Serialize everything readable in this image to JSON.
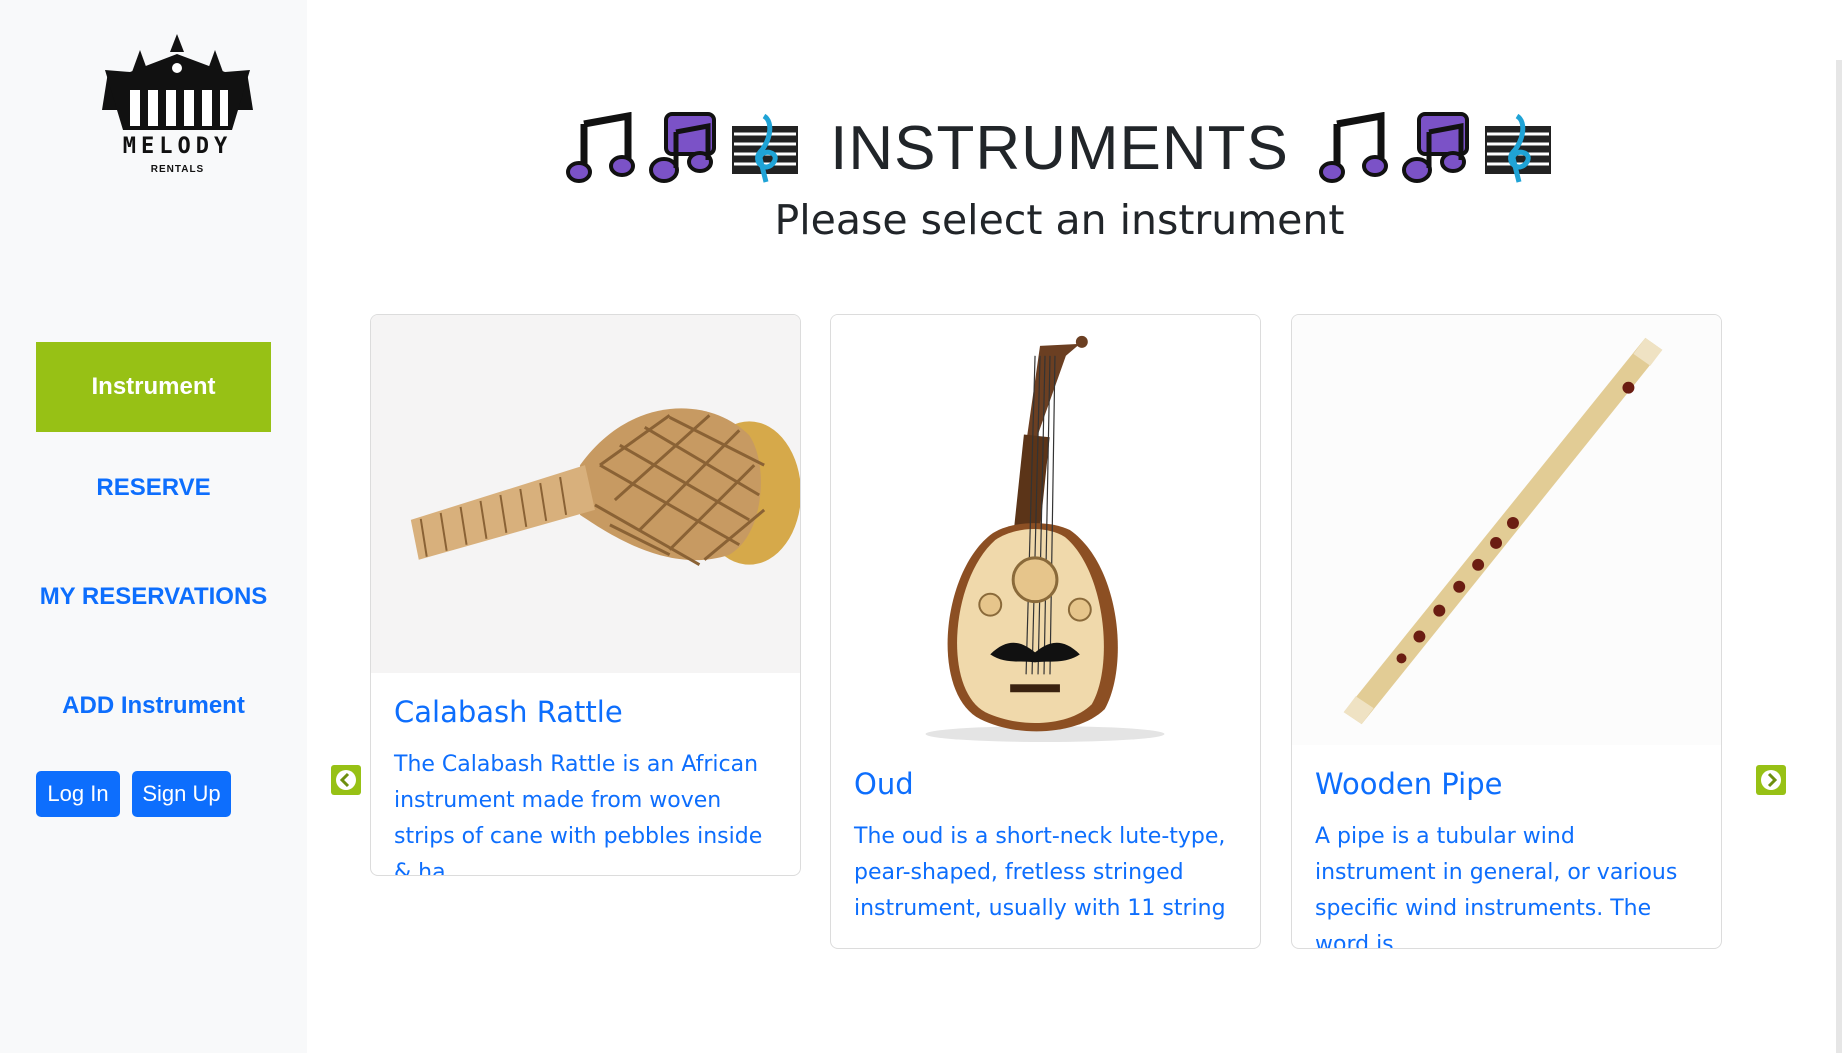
{
  "brand": {
    "name": "MELODY",
    "sub": "RENTALS"
  },
  "sidebar": {
    "items": [
      {
        "label": "Instrument",
        "active": true
      },
      {
        "label": "RESERVE"
      },
      {
        "label": "MY RESERVATIONS"
      },
      {
        "label": "ADD Instrument"
      }
    ],
    "login_label": "Log In",
    "signup_label": "Sign Up"
  },
  "header": {
    "title": "INSTRUMENTS",
    "subtitle": "Please select an instrument",
    "icons": [
      "musical-notes-icon",
      "multiple-notes-icon",
      "musical-score-icon"
    ]
  },
  "instruments": [
    {
      "name": "Calabash Rattle",
      "description": "The Calabash Rattle is an African instrument made from woven strips of cane with pebbles inside & ha ..."
    },
    {
      "name": "Oud",
      "description": "The oud is a short-neck lute-type, pear-shaped, fretless stringed instrument, usually with 11 string ..."
    },
    {
      "name": "Wooden Pipe",
      "description": "A pipe is a tubular wind instrument in general, or various specific wind instruments. The word is ..."
    }
  ],
  "colors": {
    "accent": "#97c115",
    "link": "#0d6efd",
    "sidebar_bg": "#f8f9fa",
    "icon_purple": "#7b52c7"
  }
}
